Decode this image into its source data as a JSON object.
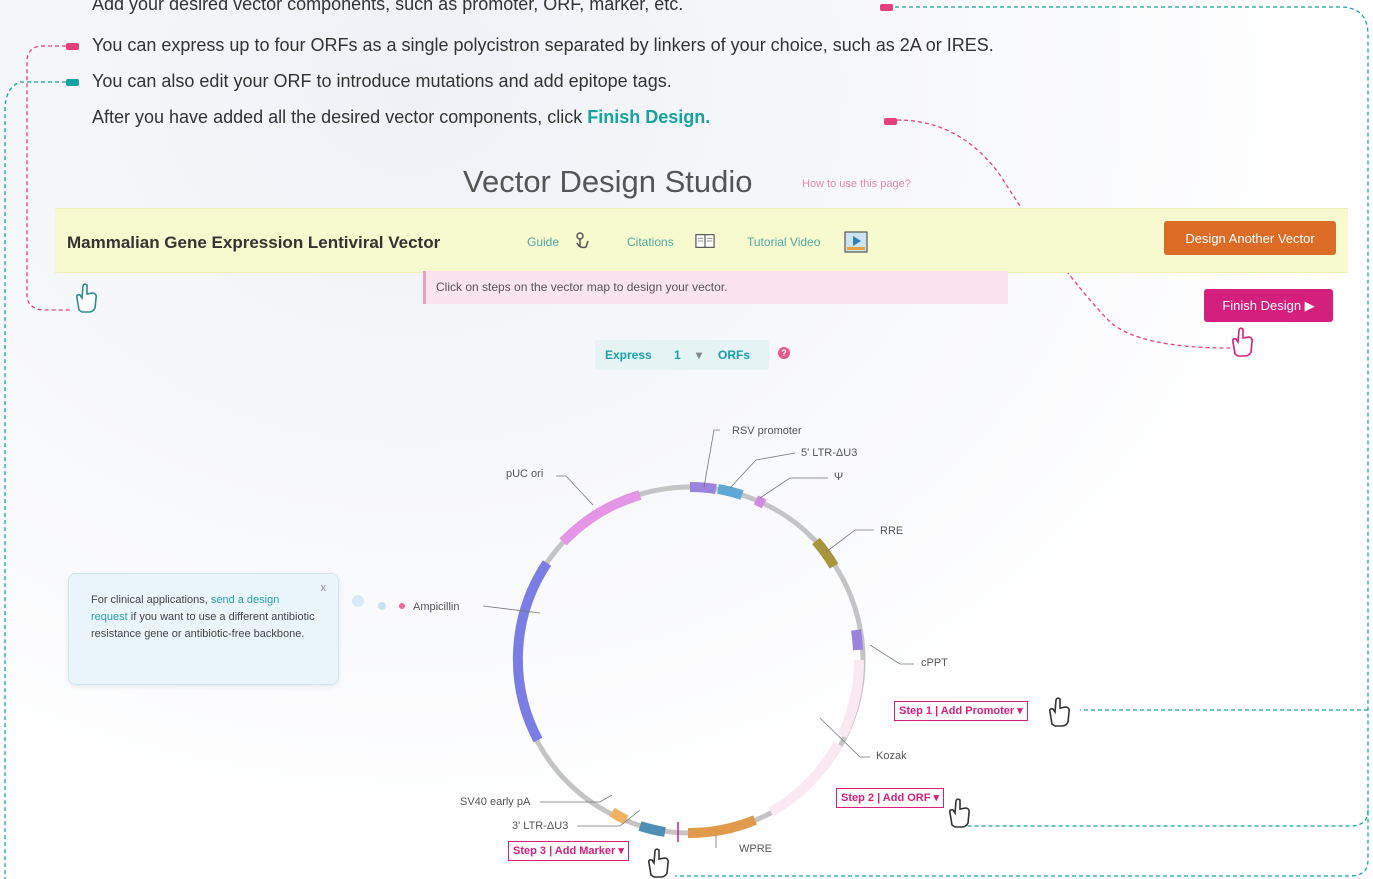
{
  "instructions": {
    "line1": "Add your desired vector components, such as promoter, ORF, marker, etc.",
    "line2": "You can express up to four ORFs as a single polycistron separated by linkers of your choice, such as 2A or IRES.",
    "line3": "You can also edit your ORF to introduce mutations and add epitope tags.",
    "line4_prefix": "After you have added all the desired vector components, click ",
    "line4_emphasis": "Finish Design."
  },
  "studio": {
    "title": "Vector Design Studio",
    "how_to": "How to use this page?"
  },
  "header": {
    "vector_title": "Mammalian Gene Expression Lentiviral Vector",
    "guide": "Guide",
    "citations": "Citations",
    "tutorial": "Tutorial Video",
    "design_another": "Design Another Vector"
  },
  "info_bar": "Click on steps on the vector map to design your vector.",
  "finish_button": "Finish Design ▶",
  "express": {
    "prefix": "Express",
    "count": "1",
    "caret": "▾",
    "suffix": "ORFs",
    "help": "?"
  },
  "clinical": {
    "text1": "For clinical applications, ",
    "link": "send a design request",
    "text2": " if you want to use a different antibiotic resistance gene or antibiotic-free backbone.",
    "close": "x"
  },
  "map_labels": {
    "rsv": "RSV promoter",
    "ltr5": "5' LTR-ΔU3",
    "psi": "Ψ",
    "rre": "RRE",
    "cppt": "cPPT",
    "kozak": "Kozak",
    "wpre": "WPRE",
    "ltr3": "3' LTR-ΔU3",
    "sv40": "SV40 early pA",
    "amp": "Ampicillin",
    "puc": "pUC ori"
  },
  "steps": {
    "step1": "Step 1 | Add Promoter ▾",
    "step2": "Step 2 | Add ORF ▾",
    "step3": "Step 3 | Add Marker ▾"
  },
  "colors": {
    "accent_teal": "#14a3a0",
    "pink": "#d51f7d",
    "orange": "#dc6b25"
  }
}
